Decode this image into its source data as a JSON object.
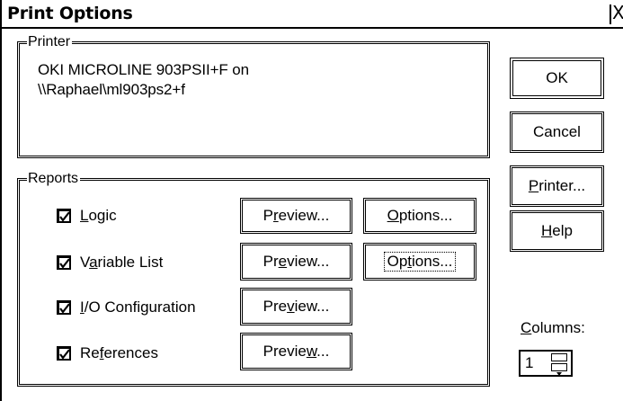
{
  "window": {
    "title": "Print Options",
    "close_glyph": "X"
  },
  "printer_group": {
    "label": "Printer",
    "line1": "OKI MICROLINE 903PSII+F on",
    "line2": "\\\\Raphael\\ml903ps2+f"
  },
  "buttons": {
    "ok": "OK",
    "cancel": "Cancel",
    "printer_pre": "",
    "printer_u": "P",
    "printer_post": "rinter...",
    "help_u": "H",
    "help_post": "elp"
  },
  "reports_group": {
    "label": "Reports",
    "rows": [
      {
        "check_u": "L",
        "check_post": "ogic",
        "checked": true,
        "preview_pre": "P",
        "preview_u": "r",
        "preview_post": "eview...",
        "options_u": "O",
        "options_post": "ptions...",
        "has_options": true
      },
      {
        "check_pre": "V",
        "check_u": "a",
        "check_post": "riable List",
        "checked": true,
        "preview_pre": "Pr",
        "preview_u": "e",
        "preview_post": "view...",
        "options_pre": "Op",
        "options_u": "t",
        "options_post": "ions...",
        "has_options": true
      },
      {
        "check_u": "I",
        "check_post": "/O Configuration",
        "checked": true,
        "preview_pre": "Pre",
        "preview_u": "v",
        "preview_post": "iew...",
        "has_options": false
      },
      {
        "check_pre": "Re",
        "check_u": "f",
        "check_post": "erences",
        "checked": true,
        "preview_pre": "Previe",
        "preview_u": "w",
        "preview_post": "...",
        "has_options": false
      }
    ]
  },
  "columns": {
    "label_u": "C",
    "label_post": "olumns:",
    "value": "1"
  }
}
